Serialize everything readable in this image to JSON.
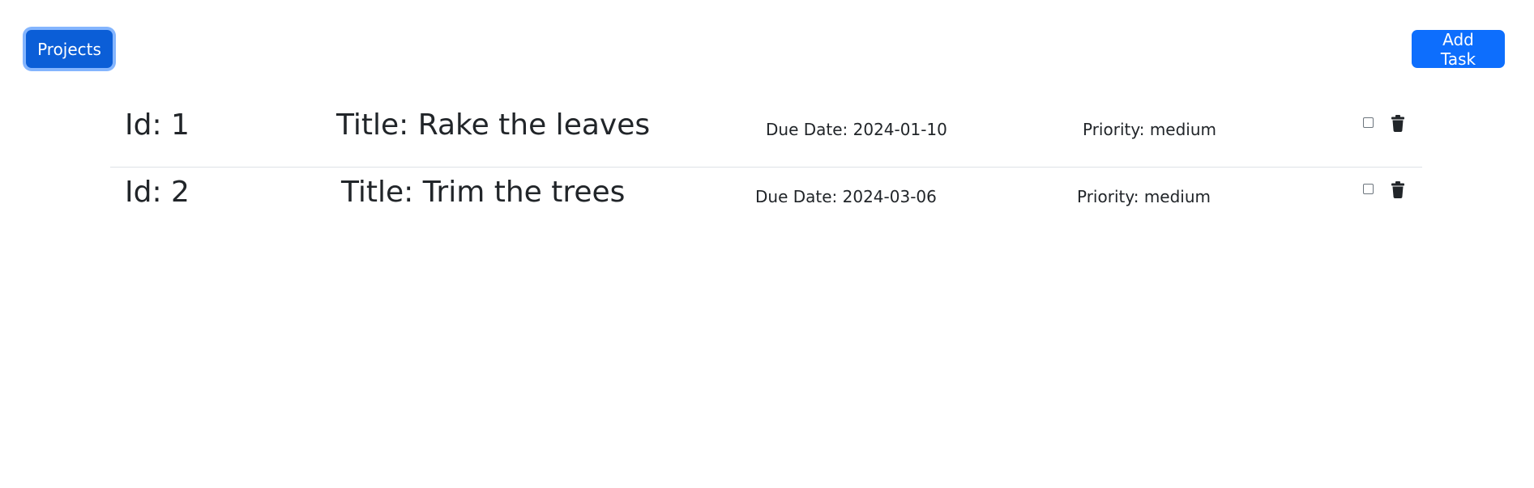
{
  "header": {
    "projects_label": "Projects",
    "add_task_label": "Add Task"
  },
  "tasks": [
    {
      "id_text": "Id: 1",
      "title_text": "Title: Rake the leaves",
      "due_text": "Due Date: 2024-01-10",
      "priority_text": "Priority: medium",
      "completed": false
    },
    {
      "id_text": "Id: 2",
      "title_text": "Title: Trim the trees",
      "due_text": "Due Date: 2024-03-06",
      "priority_text": "Priority: medium",
      "completed": false
    }
  ],
  "icons": {
    "delete": "trash-icon"
  },
  "colors": {
    "primary": "#0d6efd",
    "primary_active": "#0b5ed7",
    "text": "#212529",
    "divider": "#dee2e6"
  }
}
